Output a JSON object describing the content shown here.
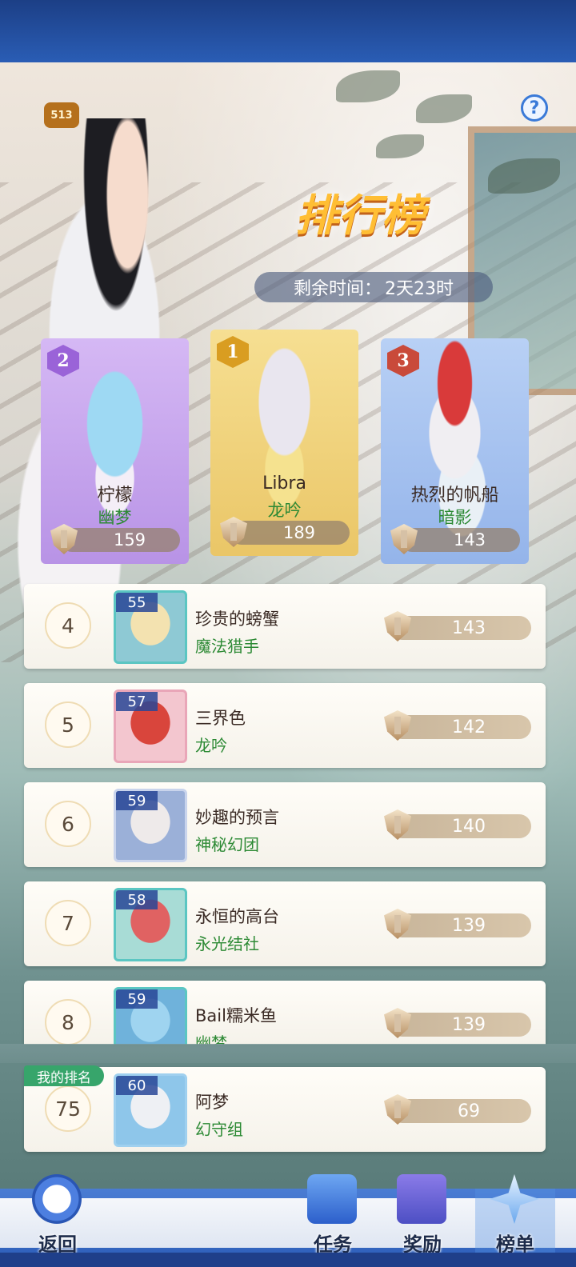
{
  "header": {
    "badge_level": "513"
  },
  "title": "排行榜",
  "timer": {
    "label": "剩余时间：",
    "value": "2天23时"
  },
  "podium": [
    {
      "rank": "2",
      "name": "柠檬",
      "guild": "幽梦",
      "score": "159",
      "color": "#c9a6f0"
    },
    {
      "rank": "1",
      "name": "Libra",
      "guild": "龙吟",
      "score": "189",
      "color": "#f1d27c"
    },
    {
      "rank": "3",
      "name": "热烈的帆船",
      "guild": "暗影",
      "score": "143",
      "color": "#a8c4ef"
    }
  ],
  "rows": [
    {
      "rank": "4",
      "level": "55",
      "name": "珍贵的螃蟹",
      "guild": "魔法猎手",
      "score": "143"
    },
    {
      "rank": "5",
      "level": "57",
      "name": "三界色",
      "guild": "龙吟",
      "score": "142"
    },
    {
      "rank": "6",
      "level": "59",
      "name": "妙趣的预言",
      "guild": "神秘幻团",
      "score": "140"
    },
    {
      "rank": "7",
      "level": "58",
      "name": "永恒的高台",
      "guild": "永光结社",
      "score": "139"
    },
    {
      "rank": "8",
      "level": "59",
      "name": "Bail糯米鱼",
      "guild": "幽梦",
      "score": "139"
    }
  ],
  "my_rank": {
    "tag": "我的排名",
    "rank": "75",
    "level": "60",
    "name": "阿梦",
    "guild": "幻守组",
    "score": "69"
  },
  "nav": {
    "back": "返回",
    "tasks": "任务",
    "rewards": "奖励",
    "list": "榜单"
  },
  "icons": {
    "help": "question-icon",
    "score": "crest-icon",
    "back": "back-arrow-icon",
    "tasks": "scroll-icon",
    "rewards": "gift-box-icon",
    "list": "star-icon"
  },
  "colors": {
    "guild_green": "#2d8a35",
    "accent_gold": "#ffbe34",
    "nav_blue": "#2b5cb8"
  }
}
